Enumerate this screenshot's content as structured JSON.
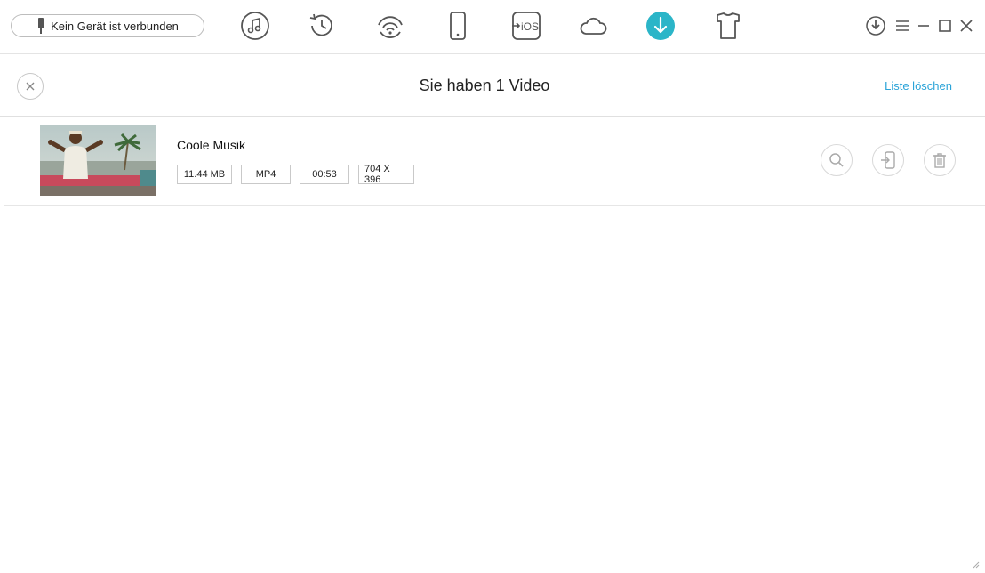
{
  "toolbar": {
    "device_status": "Kein Gerät ist verbunden",
    "nav_icons": [
      "music-note-icon",
      "history-icon",
      "wifi-sync-icon",
      "phone-icon",
      "to-ios-icon",
      "cloud-icon",
      "download-icon",
      "tshirt-icon"
    ],
    "to_ios_label": "iOS",
    "active_color": "#2bb5c8"
  },
  "header": {
    "title": "Sie haben 1 Video",
    "clear_label": "Liste löschen"
  },
  "video": {
    "title": "Coole Musik",
    "size": "11.44 MB",
    "format": "MP4",
    "duration": "00:53",
    "resolution": "704 X 396"
  },
  "colors": {
    "accent": "#2aa3d8",
    "icon_gray": "#555555"
  }
}
